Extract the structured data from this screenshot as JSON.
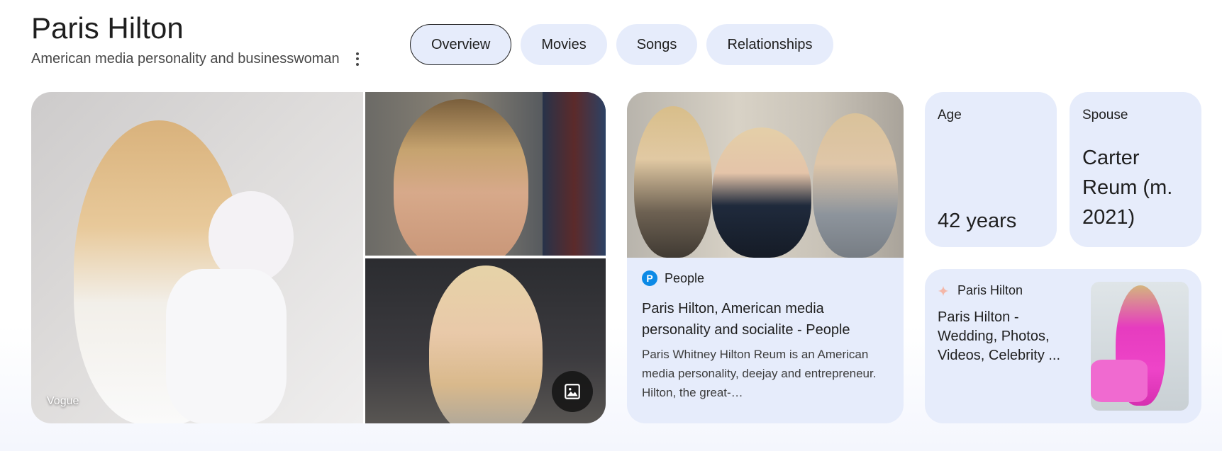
{
  "entity": {
    "name": "Paris Hilton",
    "description": "American media personality and businesswoman"
  },
  "tabs": [
    {
      "label": "Overview",
      "active": true
    },
    {
      "label": "Movies",
      "active": false
    },
    {
      "label": "Songs",
      "active": false
    },
    {
      "label": "Relationships",
      "active": false
    }
  ],
  "gallery": {
    "main_credit": "Vogue",
    "more_images_icon": "image-icon"
  },
  "news": {
    "source": "People",
    "source_logo_letter": "P",
    "title": "Paris Hilton, American media personality and socialite - People",
    "snippet": "Paris Whitney Hilton Reum is an American media personality, deejay and entrepreneur. Hilton, the great-…"
  },
  "facts": {
    "age": {
      "label": "Age",
      "value": "42 years"
    },
    "spouse": {
      "label": "Spouse",
      "value": "Carter Reum (m. 2021)"
    }
  },
  "ai_card": {
    "name": "Paris Hilton",
    "text": "Paris Hilton - Wedding, Photos, Videos, Celebrity ..."
  },
  "colors": {
    "chip_bg": "#e6ecfb",
    "text": "#1f1f1f",
    "secondary_text": "#474747"
  }
}
